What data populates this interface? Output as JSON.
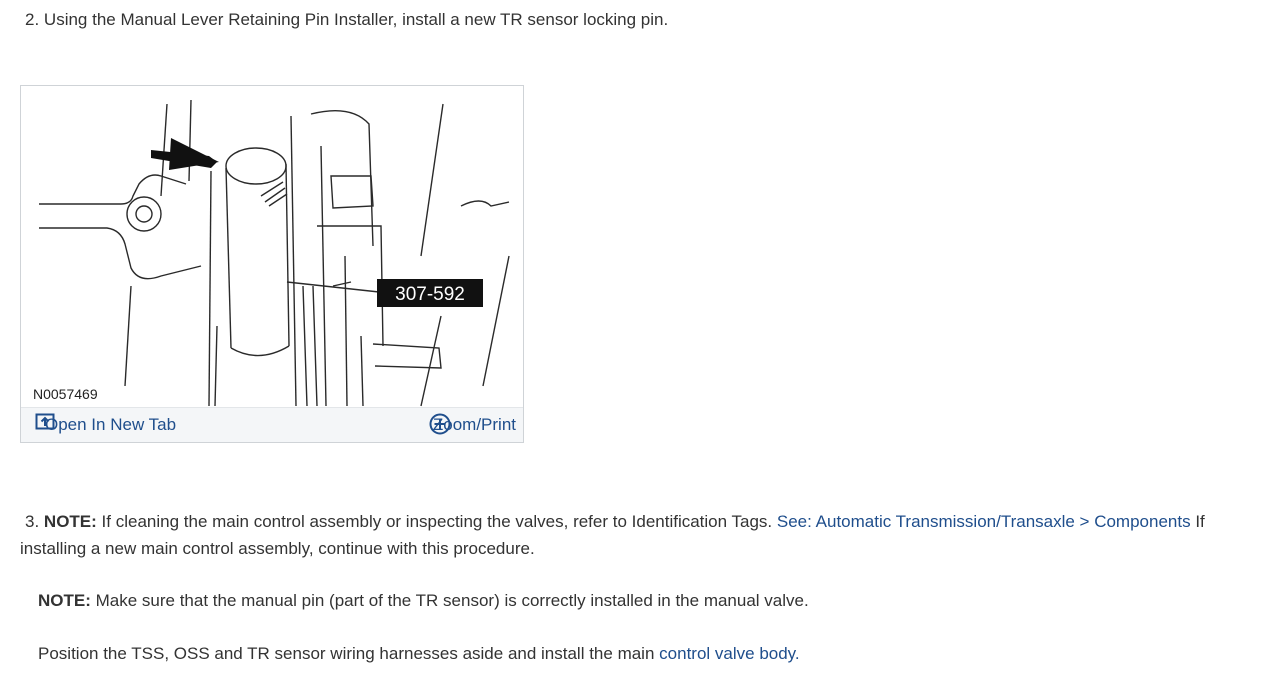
{
  "step2": {
    "number": "2.",
    "text": "Using the Manual Lever Retaining Pin Installer, install a new TR sensor locking pin."
  },
  "figure": {
    "tool_label": "307-592",
    "image_code": "N0057469",
    "open_new_tab_label": "Open In New Tab",
    "zoom_print_label": "Zoom/Print"
  },
  "step3": {
    "number": "3.",
    "note_label": "NOTE:",
    "text_before_link": "If cleaning the main control assembly or inspecting the valves, refer to Identification Tags.",
    "link_text": "See: Automatic Transmission/Transaxle > Components",
    "text_after_link": "If installing a new main control assembly, continue with this procedure."
  },
  "note2": {
    "label": "NOTE:",
    "text": "Make sure that the manual pin (part of the TR sensor) is correctly installed in the manual valve."
  },
  "position_step": {
    "text": "Position the TSS, OSS and TR sensor wiring harnesses aside and install the main",
    "link_text": "control valve body."
  },
  "colors": {
    "link": "#1f4e8c",
    "text": "#333333"
  }
}
